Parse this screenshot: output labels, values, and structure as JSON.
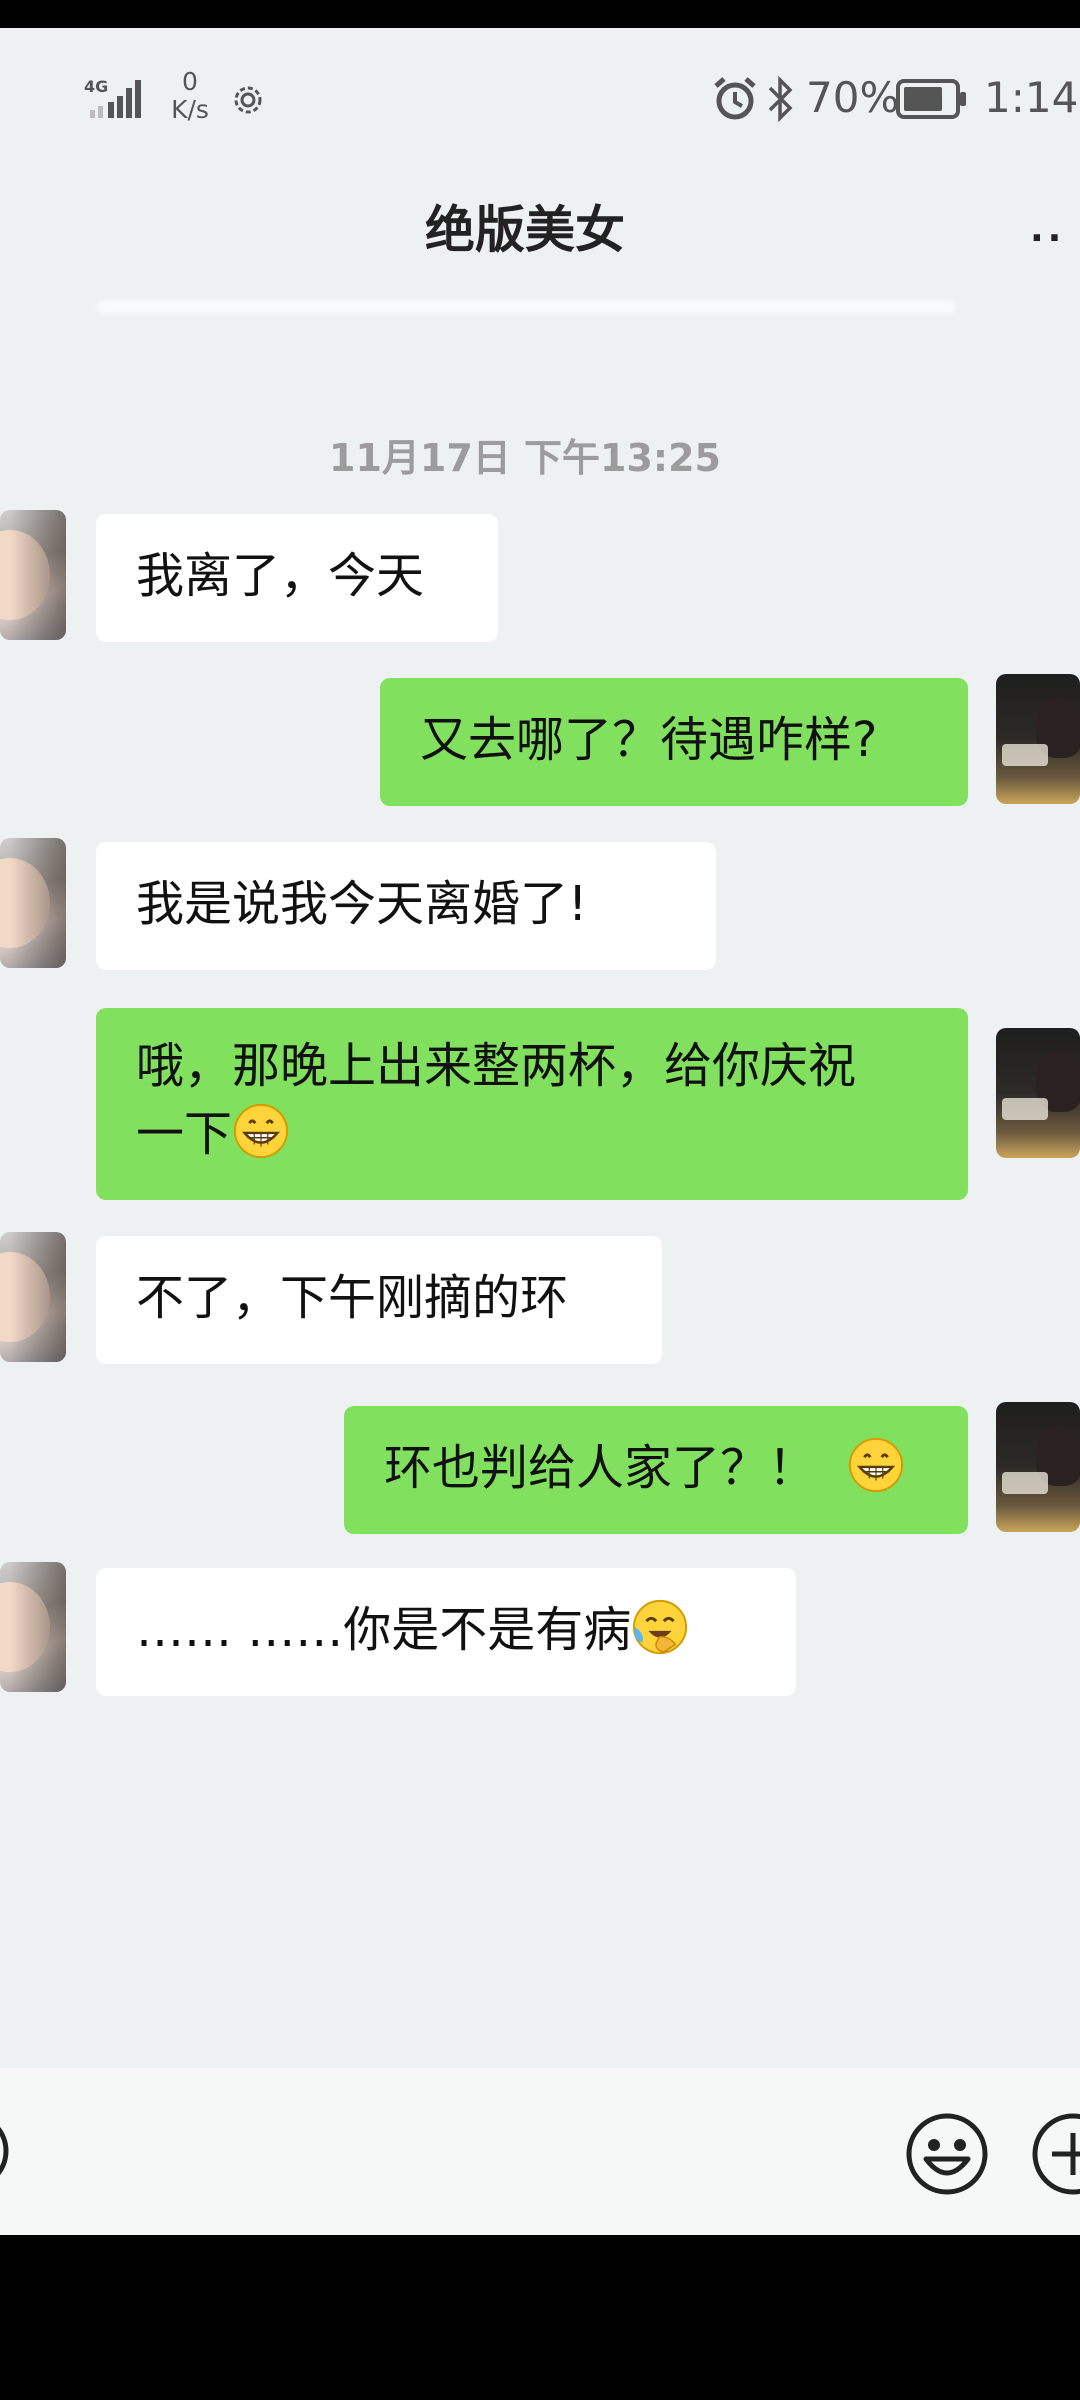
{
  "status_bar": {
    "network_type": "4G",
    "net_speed_value": "0",
    "net_speed_unit": "K/s",
    "battery_percent": "70%",
    "time": "1:14"
  },
  "header": {
    "title": "绝版美女",
    "more": "··"
  },
  "timestamp": "11月17日 下午13:25",
  "messages": [
    {
      "side": "left",
      "text": "我离了，今天"
    },
    {
      "side": "right",
      "text": "又去哪了？待遇咋样?"
    },
    {
      "side": "left",
      "text": "我是说我今天离婚了!"
    },
    {
      "side": "right",
      "text_line1": "哦，那晚上出来整两杯，给你庆祝",
      "text_line2": "一下",
      "emoji": "grin-emoji"
    },
    {
      "side": "left",
      "text": "不了，下午刚摘的环"
    },
    {
      "side": "right",
      "text": "环也判给人家了？！",
      "emoji": "grin-emoji"
    },
    {
      "side": "left",
      "text": "…… ……你是不是有病",
      "emoji": "crying-laughing-emoji"
    }
  ],
  "colors": {
    "chat_background": "#edf1f2",
    "incoming_bubble": "#ffffff",
    "outgoing_bubble": "#82e05f"
  },
  "icons": [
    "signal-icon",
    "gear-icon",
    "alarm-icon",
    "bluetooth-icon",
    "battery-icon",
    "voice-icon",
    "emoji-button-icon",
    "plus-icon"
  ]
}
